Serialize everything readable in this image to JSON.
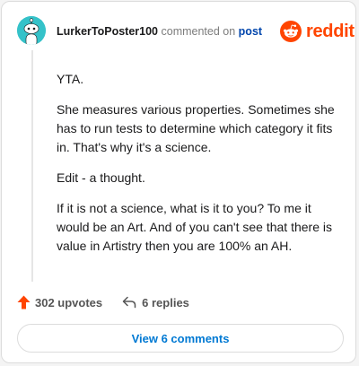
{
  "comment": {
    "username": "LurkerToPoster100",
    "action_text": "commented on",
    "post_link": "post",
    "paragraphs": [
      "YTA.",
      "She measures various properties. Sometimes she has to run tests to determine which category it fits in. That's why it's a science.",
      "Edit - a thought.",
      "If it is not a science, what is it to you? To me it would be an Art. And of you can't see that there is value in Artistry then you are 100% an AH."
    ],
    "upvotes_label": "302 upvotes",
    "replies_label": "6 replies",
    "view_button_label": "View 6 comments"
  },
  "brand": {
    "wordmark": "reddit",
    "icon": "reddit-snoo-icon"
  },
  "colors": {
    "brand_orange": "#ff4500",
    "avatar_teal": "#35c2c9",
    "link_blue": "#0045ac",
    "button_blue": "#0079d3"
  }
}
